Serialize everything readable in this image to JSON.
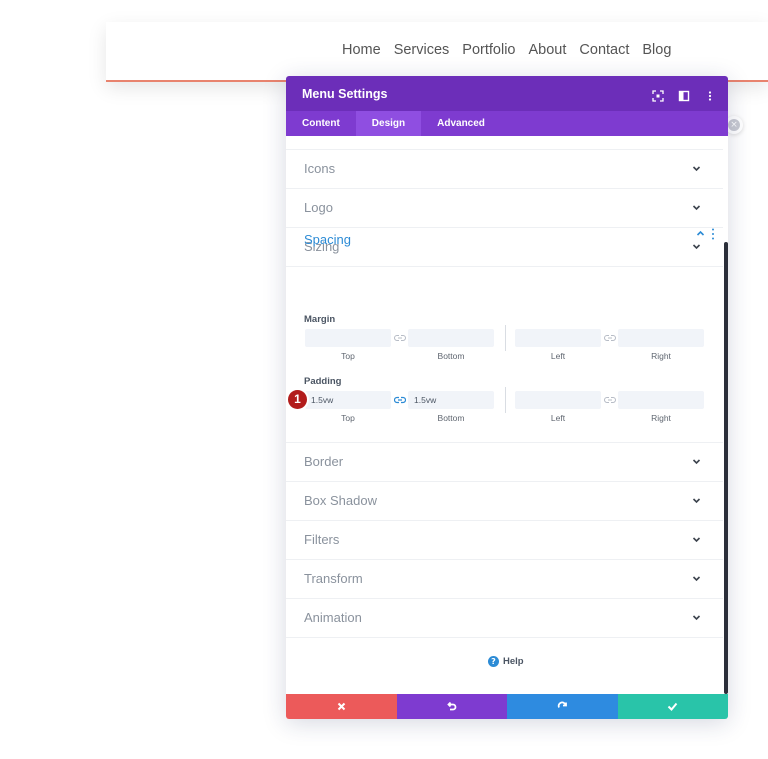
{
  "site_nav": [
    "Home",
    "Services",
    "Portfolio",
    "About",
    "Contact",
    "Blog"
  ],
  "modal": {
    "title": "Menu Settings",
    "tabs": [
      {
        "label": "Content",
        "active": false
      },
      {
        "label": "Design",
        "active": true
      },
      {
        "label": "Advanced",
        "active": false
      }
    ]
  },
  "sections_top": [
    "Icons",
    "Logo",
    "Sizing"
  ],
  "spacing": {
    "title": "Spacing",
    "margin_label": "Margin",
    "padding_label": "Padding",
    "sub_labels": [
      "Top",
      "Bottom",
      "Left",
      "Right"
    ],
    "padding_values": {
      "top": "1.5vw",
      "bottom": "1.5vw"
    }
  },
  "sections_bottom": [
    "Border",
    "Box Shadow",
    "Filters",
    "Transform",
    "Animation"
  ],
  "badge": "1",
  "help_label": "Help",
  "colors": {
    "header": "#6c2eb9",
    "tabs": "#7e3bd0",
    "accent_blue": "#2c8bd5",
    "cancel": "#ec5a5a",
    "undo": "#7e3bd0",
    "redo": "#2e8be0",
    "save": "#29c4a9"
  },
  "footer_icons": [
    "close-icon",
    "undo-icon",
    "redo-icon",
    "check-icon"
  ]
}
